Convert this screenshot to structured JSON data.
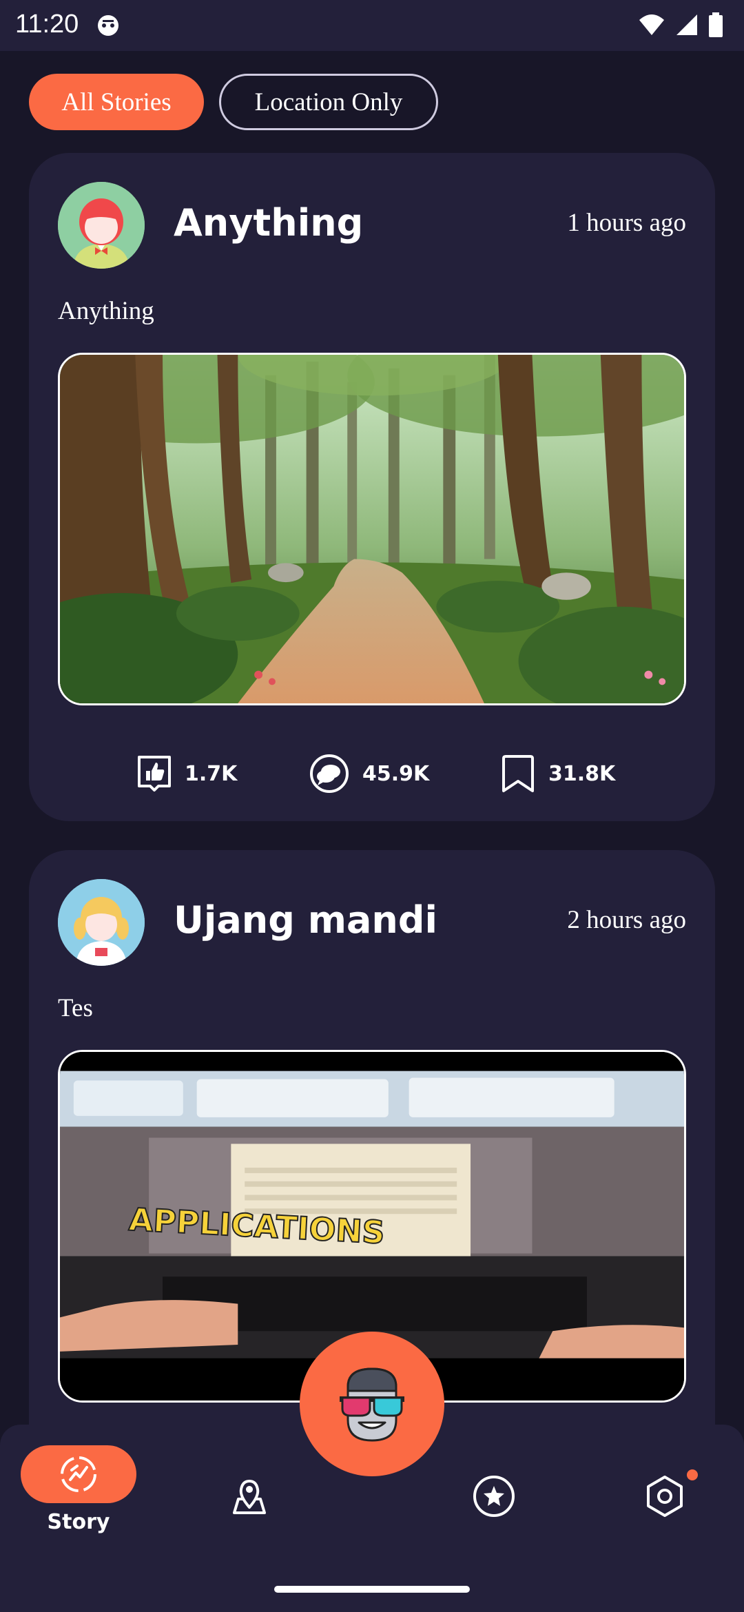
{
  "status_bar": {
    "time": "11:20"
  },
  "filters": {
    "all_stories": "All Stories",
    "location_only": "Location Only"
  },
  "stories": [
    {
      "author": "Anything",
      "time_ago": "1 hours ago",
      "caption": "Anything",
      "photo": "forest-path-illustration",
      "likes": "1.7K",
      "comments": "45.9K",
      "bookmarks": "31.8K"
    },
    {
      "author": "Ujang mandi",
      "time_ago": "2 hours ago",
      "caption": "Tes",
      "photo": "phone-screenshot-photo"
    }
  ],
  "nav": {
    "story_label": "Story",
    "items": [
      "story-icon",
      "map-pin-icon",
      "ai-assistant-button",
      "star-icon",
      "settings-icon"
    ]
  },
  "colors": {
    "accent": "#fb6a44",
    "background": "#181628",
    "card": "#23203a",
    "text": "#ffffff"
  }
}
